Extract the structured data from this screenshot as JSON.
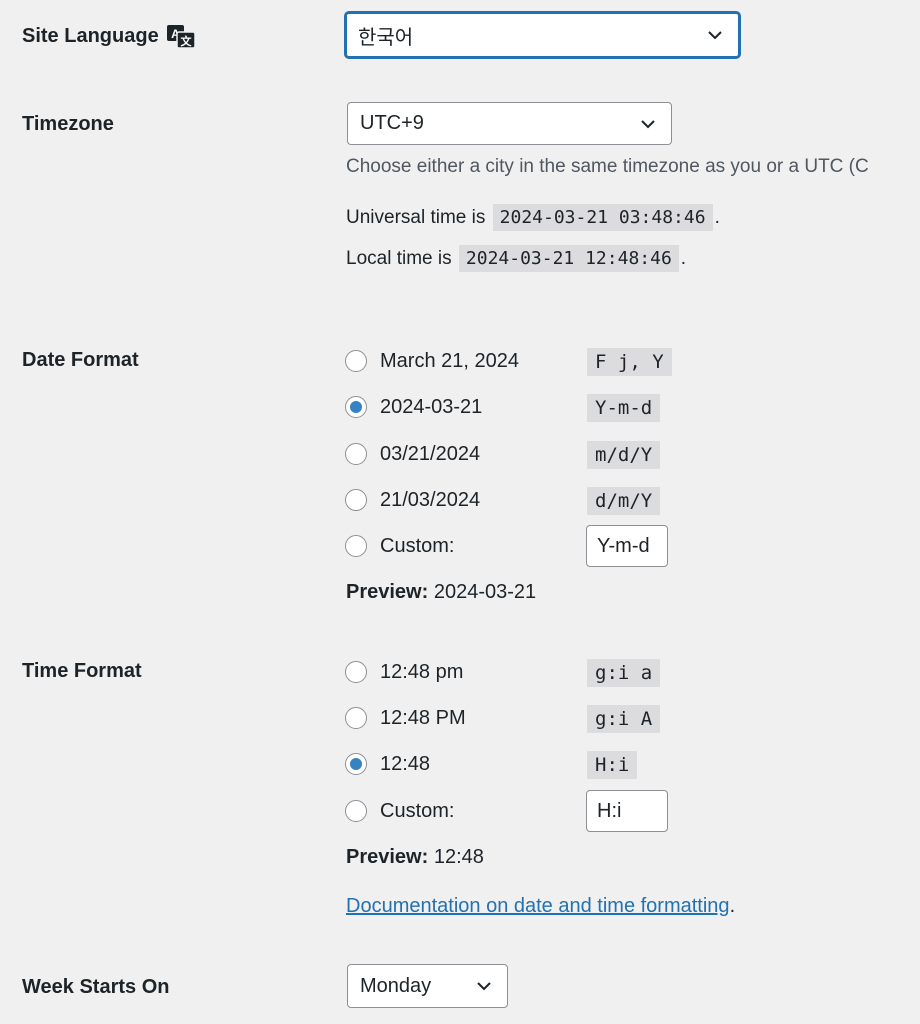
{
  "site_language": {
    "label": "Site Language",
    "icon": "translation-icon",
    "selected": "한국어"
  },
  "timezone": {
    "label": "Timezone",
    "selected": "UTC+9",
    "description": "Choose either a city in the same timezone as you or a UTC (C",
    "universal_prefix": "Universal time is",
    "universal_time": "2024-03-21 03:48:46",
    "local_prefix": "Local time is",
    "local_time": "2024-03-21 12:48:46",
    "suffix": "."
  },
  "date_format": {
    "label": "Date Format",
    "options": [
      {
        "label": "March 21, 2024",
        "format": "F j, Y",
        "checked": false
      },
      {
        "label": "2024-03-21",
        "format": "Y-m-d",
        "checked": true
      },
      {
        "label": "03/21/2024",
        "format": "m/d/Y",
        "checked": false
      },
      {
        "label": "21/03/2024",
        "format": "d/m/Y",
        "checked": false
      },
      {
        "label": "Custom:",
        "custom_value": "Y-m-d",
        "checked": false
      }
    ],
    "preview_label": "Preview:",
    "preview_value": "2024-03-21"
  },
  "time_format": {
    "label": "Time Format",
    "options": [
      {
        "label": "12:48 pm",
        "format": "g:i a",
        "checked": false
      },
      {
        "label": "12:48 PM",
        "format": "g:i A",
        "checked": false
      },
      {
        "label": "12:48",
        "format": "H:i",
        "checked": true
      },
      {
        "label": "Custom:",
        "custom_value": "H:i",
        "checked": false
      }
    ],
    "preview_label": "Preview:",
    "preview_value": "12:48",
    "doc_link": "Documentation on date and time formatting",
    "doc_suffix": "."
  },
  "week_start": {
    "label": "Week Starts On",
    "selected": "Monday"
  },
  "colors": {
    "accent": "#2271b1",
    "radio_checked": "#3582c4",
    "background": "#f0f0f1"
  }
}
